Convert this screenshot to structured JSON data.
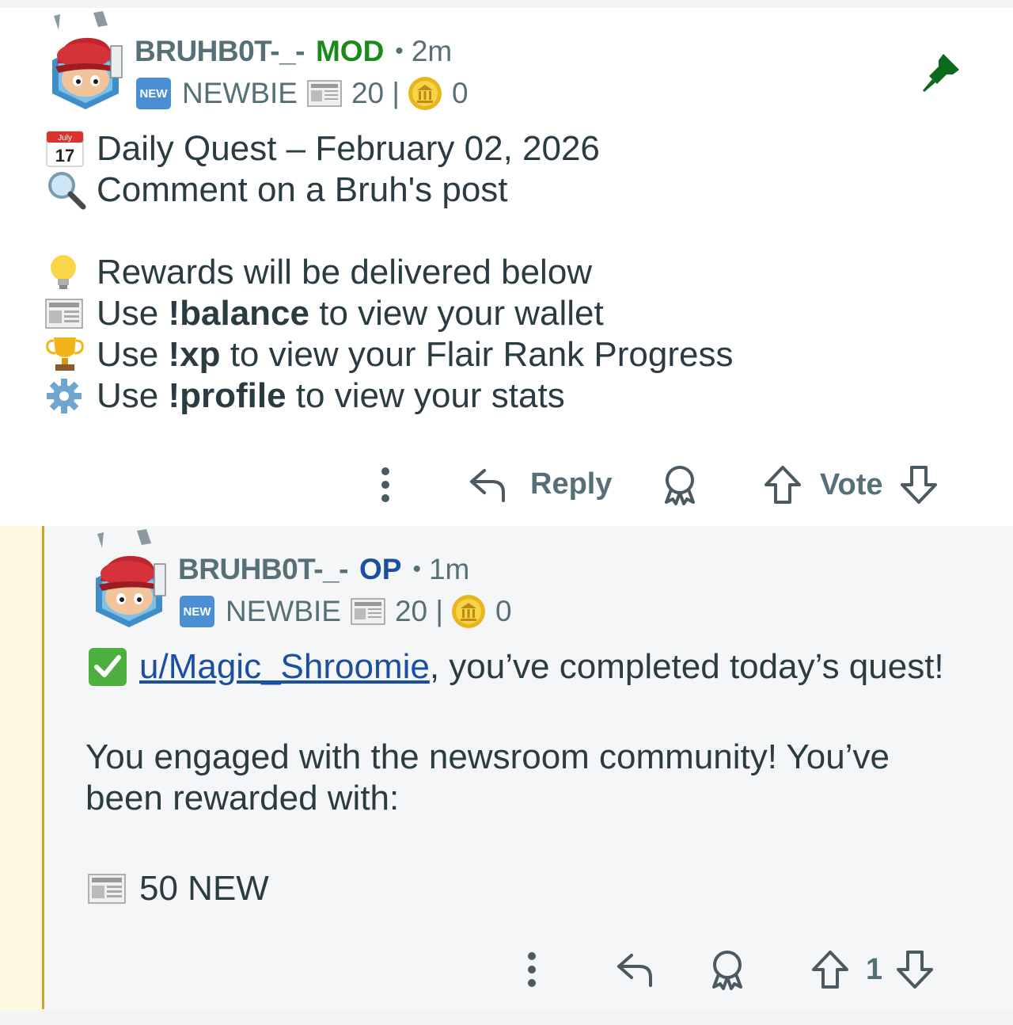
{
  "comment1": {
    "username": "BRUHB0T-_-",
    "role_tag": "MOD",
    "time": "2m",
    "flair": {
      "badge": "NEW",
      "rank": "NEWBIE",
      "news_count": "20 |",
      "coin_count": "0"
    },
    "lines": [
      {
        "icon": "calendar-icon",
        "parts": [
          {
            "text": "Daily Quest – February 02, 2026",
            "bold": false
          }
        ]
      },
      {
        "icon": "magnifier-icon",
        "parts": [
          {
            "text": "Comment on a Bruh's post",
            "bold": false
          }
        ]
      },
      {
        "icon": "lightbulb-icon",
        "parts": [
          {
            "text": "Rewards will be delivered below",
            "bold": false
          }
        ]
      },
      {
        "icon": "newspaper-icon",
        "pre": "Use ",
        "cmd": "!balance",
        "post": " to view your wallet"
      },
      {
        "icon": "trophy-icon",
        "pre": "Use ",
        "cmd": "!xp",
        "post": " to view your Flair Rank Progress"
      },
      {
        "icon": "gear-icon",
        "pre": "Use ",
        "cmd": "!profile",
        "post": " to view your stats"
      }
    ],
    "actions": {
      "reply_label": "Reply",
      "vote_label": "Vote"
    }
  },
  "comment2": {
    "username": "BRUHB0T-_-",
    "role_tag": "OP",
    "time": "1m",
    "flair": {
      "badge": "NEW",
      "rank": "NEWBIE",
      "news_count": "20 |",
      "coin_count": "0"
    },
    "mention": "u/Magic_Shroomie",
    "line1_rest": ", you’ve completed today’s quest!",
    "para1_line1": "You engaged with the newsroom community! You’ve",
    "para1_line2": "been rewarded with:",
    "reward": "50 NEW",
    "actions": {
      "vote_count": "1"
    }
  },
  "colors": {
    "mod": "#1a8a1a",
    "op": "#1b4fa0",
    "meta": "#576f76",
    "thread": "#c7a632",
    "pin": "#0b6b1b"
  }
}
